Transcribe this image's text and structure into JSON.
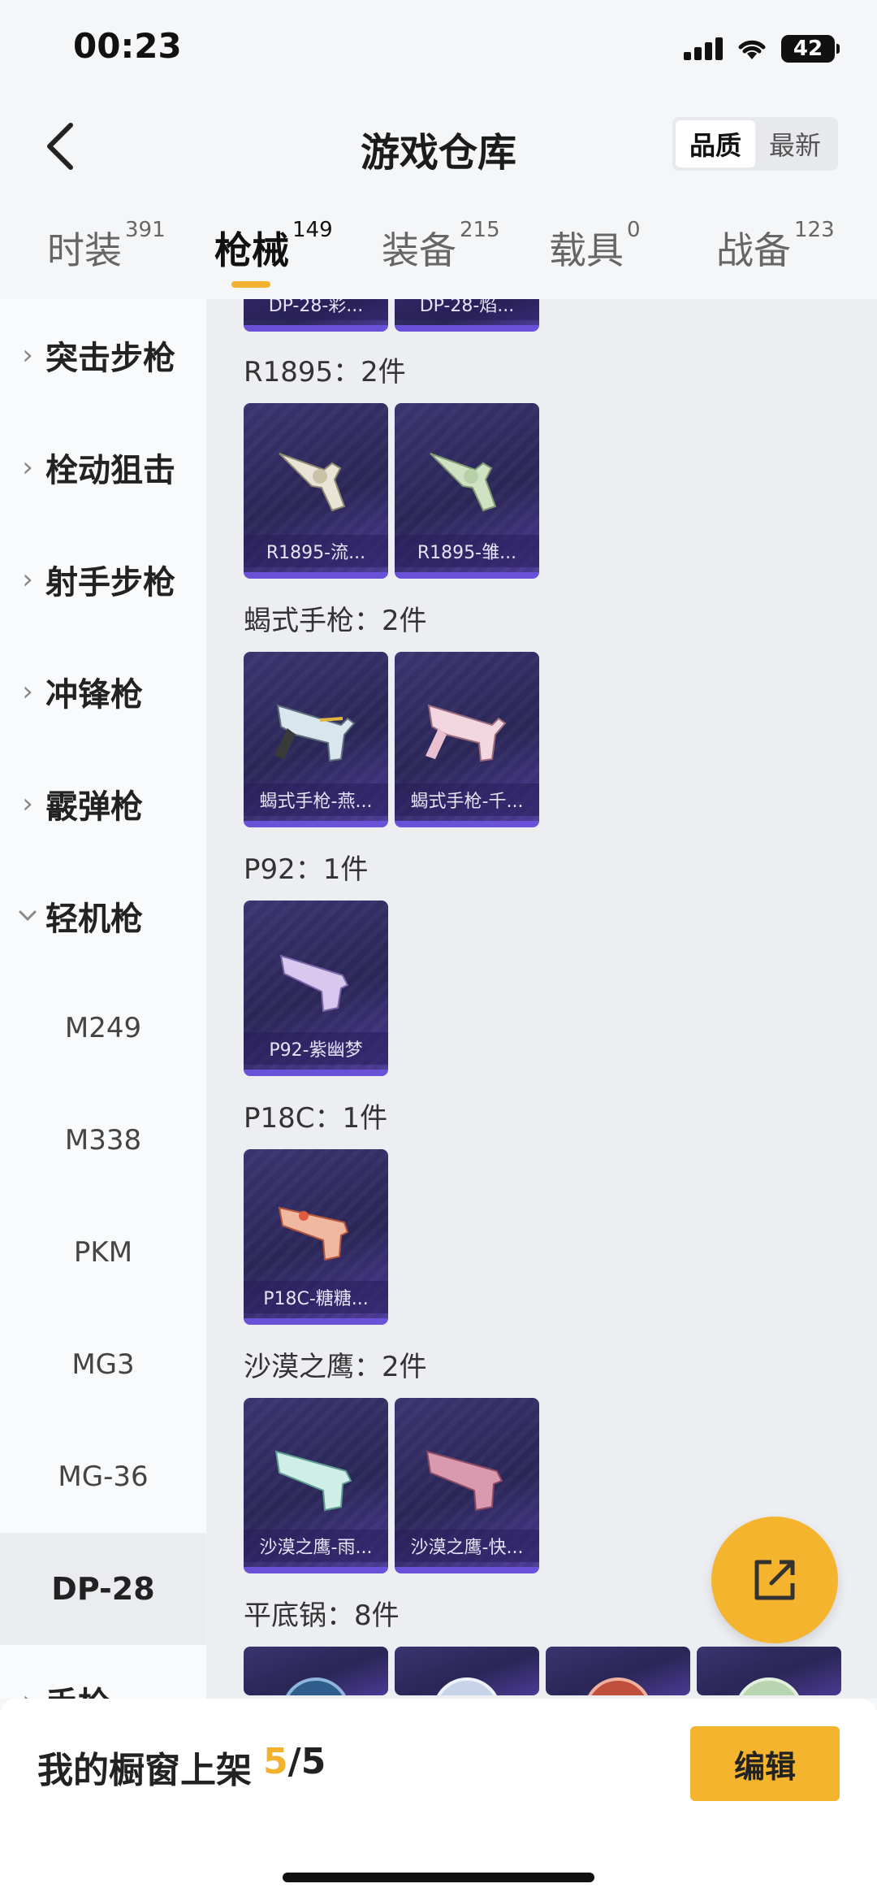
{
  "status_bar": {
    "time": "00:23",
    "battery": "42"
  },
  "header": {
    "title": "游戏仓库",
    "sort_options": [
      "品质",
      "最新"
    ],
    "sort_active": "品质"
  },
  "tabs": [
    {
      "label": "时装",
      "count": "391"
    },
    {
      "label": "枪械",
      "count": "149"
    },
    {
      "label": "装备",
      "count": "215"
    },
    {
      "label": "载具",
      "count": "0"
    },
    {
      "label": "战备",
      "count": "123"
    }
  ],
  "active_tab": "枪械",
  "sidebar": {
    "categories": [
      "突击步枪",
      "栓动狙击",
      "射手步枪",
      "冲锋枪",
      "霰弹枪",
      "轻机枪"
    ],
    "sub_items": [
      "M249",
      "M338",
      "PKM",
      "MG3",
      "MG-36",
      "DP-28"
    ],
    "active_sub": "DP-28",
    "partial_item": "手枪"
  },
  "groups": [
    {
      "title": "",
      "items": [
        "DP-28-彩...",
        "DP-28-焰..."
      ]
    },
    {
      "title": "R1895：2件",
      "items": [
        "R1895-流...",
        "R1895-雏..."
      ]
    },
    {
      "title": "蝎式手枪：2件",
      "items": [
        "蝎式手枪-燕...",
        "蝎式手枪-千..."
      ]
    },
    {
      "title": "P92：1件",
      "items": [
        "P92-紫幽梦"
      ]
    },
    {
      "title": "P18C：1件",
      "items": [
        "P18C-糖糖..."
      ]
    },
    {
      "title": "沙漠之鹰：2件",
      "items": [
        "沙漠之鹰-雨...",
        "沙漠之鹰-快..."
      ]
    },
    {
      "title": "平底锅：8件",
      "items": [
        "",
        "",
        "",
        ""
      ]
    }
  ],
  "bottom_bar": {
    "label": "我的橱窗上架",
    "current": "5",
    "separator": "/",
    "total": "5",
    "edit_label": "编辑"
  },
  "colors": {
    "accent": "#f4b42e",
    "card_purple": "#3b3470",
    "card_border": "#6a52d8"
  }
}
